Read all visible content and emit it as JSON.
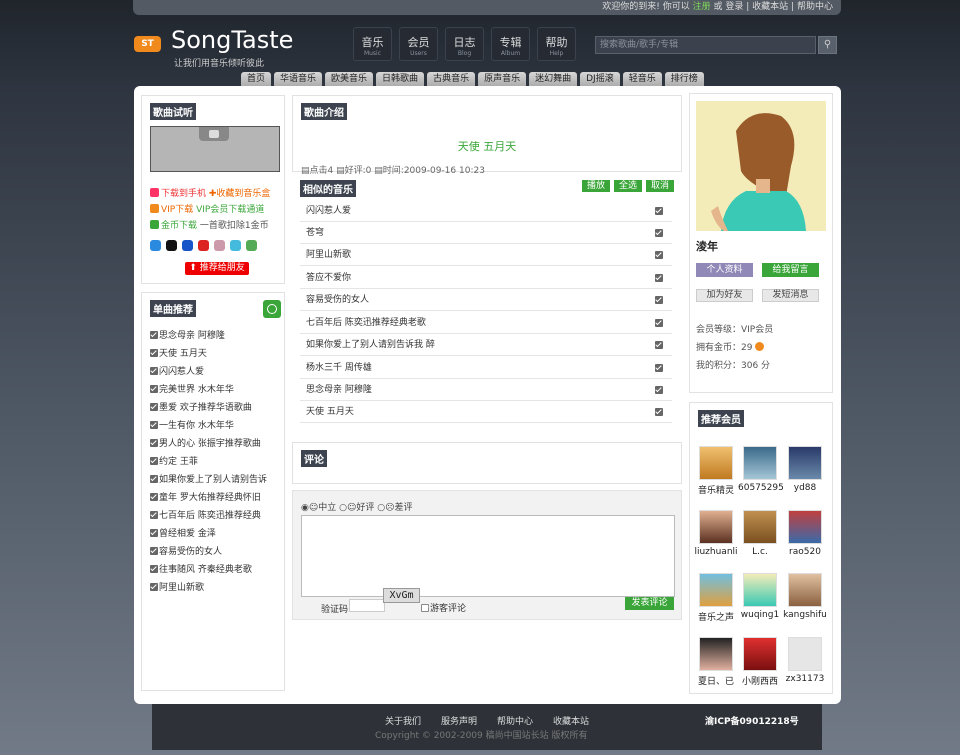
{
  "topbar": {
    "welcome": "欢迎你的到来!",
    "can": "你可以",
    "register": "注册",
    "or": "或",
    "login": "登录",
    "sep": "|",
    "bookmark": "收藏本站",
    "sep2": "|",
    "help": "帮助中心"
  },
  "logo": {
    "badge": "ST",
    "name": "SongTaste",
    "slogan": "让我们用音乐倾听彼此"
  },
  "mainnav": [
    {
      "cn": "音乐",
      "en": "Music"
    },
    {
      "cn": "会员",
      "en": "Users"
    },
    {
      "cn": "日志",
      "en": "Blog"
    },
    {
      "cn": "专辑",
      "en": "Album"
    },
    {
      "cn": "帮助",
      "en": "Help"
    }
  ],
  "search": {
    "placeholder": "搜索歌曲/歌手/专辑",
    "button_icon": "magnifier-icon"
  },
  "tabs": [
    "首页",
    "华语音乐",
    "欧美音乐",
    "日韩歌曲",
    "古典音乐",
    "原声音乐",
    "迷幻舞曲",
    "DJ摇滚",
    "轻音乐",
    "排行榜"
  ],
  "trial": {
    "title": "歌曲试听",
    "dl_phone": "下载到手机",
    "dl_box": "✚收藏到音乐盒",
    "vip_dl": "VIP下载",
    "vip_desc": "VIP会员下载通道",
    "gold_dl": "金币下载",
    "gold_desc": "一首歌扣除1金币",
    "recommend": "推荐给朋友"
  },
  "singles": {
    "title": "单曲推荐",
    "items": [
      "思念母亲 阿穆隆",
      "天使 五月天",
      "闪闪惹人爱",
      "完美世界 水木年华",
      "墨爱 欢子推荐华语歌曲",
      "一生有你 水木年华",
      "男人的心 张振宇推荐歌曲",
      "约定 王菲",
      "如果你爱上了别人请别告诉",
      "童年 罗大佑推荐经典怀旧",
      "七百年后 陈奕迅推荐经典",
      "曾经相爱 金泽",
      "容易受伤的女人",
      "往事随风 齐秦经典老歌",
      "阿里山新歌"
    ]
  },
  "intro": {
    "title": "歌曲介绍",
    "song": "天使 五月天",
    "clicks": "点击4",
    "good": "好评:0",
    "time": "时间:2009-09-16 10:23"
  },
  "similar": {
    "title": "相似的音乐",
    "play": "播放",
    "all": "全选",
    "cancel": "取消",
    "items": [
      "闪闪惹人爱",
      "苍穹",
      "阿里山新歌",
      "答应不爱你",
      "容易受伤的女人",
      "七百年后 陈奕迅推荐经典老歌",
      "如果你爱上了别人请别告诉我 醉",
      "杨水三千 周传雄",
      "思念母亲 阿穆隆",
      "天使 五月天"
    ]
  },
  "comments": {
    "title": "评论"
  },
  "form": {
    "neutral": "中立",
    "good": "好评",
    "bad": "差评",
    "code_label": "验证码",
    "captcha": "XvGm",
    "guest": "游客评论",
    "submit": "发表评论"
  },
  "profile": {
    "name": "淩年",
    "info_btn": "个人资料",
    "msg_btn": "给我留言",
    "add_friend": "加为好友",
    "send_msg": "发短消息",
    "level": "会员等级：VIP会员",
    "gold": "拥有金币：29",
    "points": "我的积分：306 分"
  },
  "members": {
    "title": "推荐会员",
    "items": [
      "音乐精灵",
      "60575295",
      "yd88",
      "liuzhuanli",
      "L.c.",
      "rao520",
      "音乐之声",
      "wuqing1",
      "kangshifu",
      "夏日、已",
      "小刚西西",
      "zx31173"
    ]
  },
  "footer": {
    "links": [
      "关于我们",
      "服务声明",
      "帮助中心",
      "收藏本站"
    ],
    "copy": "Copyright © 2002-2009 稿尚中国站长站 版权所有",
    "icp": "渝ICP备09012218号"
  },
  "colors": {
    "accent_green": "#3aa63a",
    "logo_orange": "#f08a1c",
    "header_bg": "#20252c"
  }
}
